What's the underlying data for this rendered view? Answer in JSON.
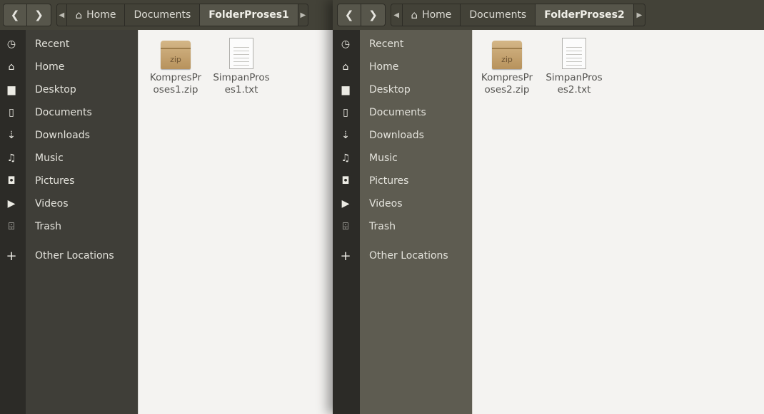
{
  "windows": [
    {
      "nav": {
        "back_icon": "chevron-left-icon",
        "forward_icon": "chevron-right-icon"
      },
      "breadcrumb": {
        "home_label": "Home",
        "documents_label": "Documents",
        "current_label": "FolderProses1"
      },
      "sidebar": [
        {
          "label": "Recent",
          "icon": "clock-icon"
        },
        {
          "label": "Home",
          "icon": "home-icon"
        },
        {
          "label": "Desktop",
          "icon": "folder-icon"
        },
        {
          "label": "Documents",
          "icon": "document-icon"
        },
        {
          "label": "Downloads",
          "icon": "download-icon"
        },
        {
          "label": "Music",
          "icon": "music-icon"
        },
        {
          "label": "Pictures",
          "icon": "camera-icon"
        },
        {
          "label": "Videos",
          "icon": "video-icon"
        },
        {
          "label": "Trash",
          "icon": "trash-icon"
        },
        {
          "label": "Other Locations",
          "icon": "plus-icon"
        }
      ],
      "files": [
        {
          "name": "KompresProses1.zip",
          "icon": "zip-archive-icon",
          "badge": "zip"
        },
        {
          "name": "SimpanProses1.txt",
          "icon": "text-file-icon"
        }
      ]
    },
    {
      "nav": {
        "back_icon": "chevron-left-icon",
        "forward_icon": "chevron-right-icon"
      },
      "breadcrumb": {
        "home_label": "Home",
        "documents_label": "Documents",
        "current_label": "FolderProses2"
      },
      "sidebar": [
        {
          "label": "Recent",
          "icon": "clock-icon"
        },
        {
          "label": "Home",
          "icon": "home-icon"
        },
        {
          "label": "Desktop",
          "icon": "folder-icon"
        },
        {
          "label": "Documents",
          "icon": "document-icon"
        },
        {
          "label": "Downloads",
          "icon": "download-icon"
        },
        {
          "label": "Music",
          "icon": "music-icon"
        },
        {
          "label": "Pictures",
          "icon": "camera-icon"
        },
        {
          "label": "Videos",
          "icon": "video-icon"
        },
        {
          "label": "Trash",
          "icon": "trash-icon"
        },
        {
          "label": "Other Locations",
          "icon": "plus-icon"
        }
      ],
      "files": [
        {
          "name": "KompresProses2.zip",
          "icon": "zip-archive-icon",
          "badge": "zip"
        },
        {
          "name": "SimpanProses2.txt",
          "icon": "text-file-icon"
        }
      ]
    }
  ]
}
